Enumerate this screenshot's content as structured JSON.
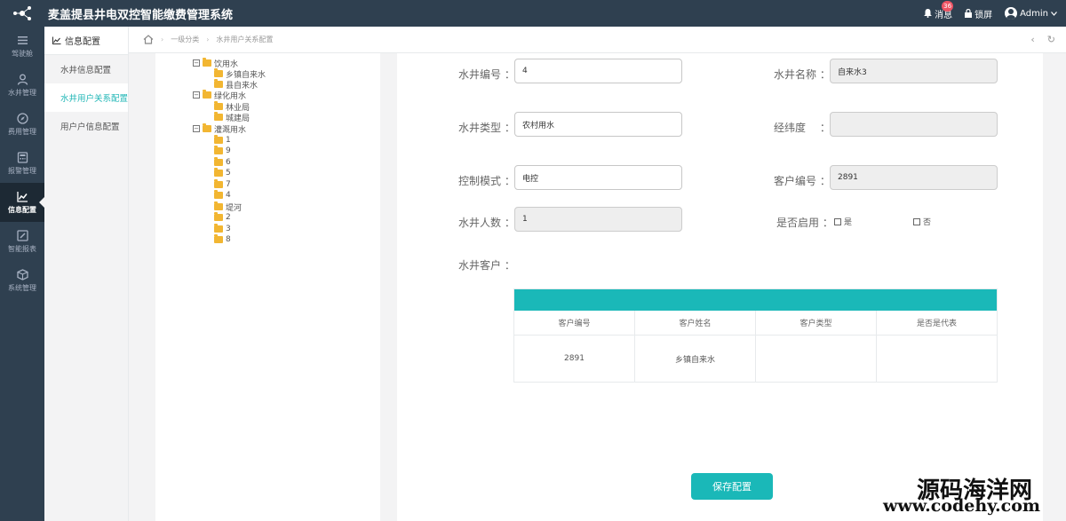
{
  "app": {
    "title": "麦盖提县井电双控智能缴费管理系统"
  },
  "topbar": {
    "messages_label": "消息",
    "messages_count": "36",
    "lock_label": "锁屏",
    "user_label": "Admin"
  },
  "nav": [
    {
      "label": "驾驶舱",
      "icon": "menu-icon"
    },
    {
      "label": "水井管理",
      "icon": "user-icon"
    },
    {
      "label": "费用管理",
      "icon": "compass-icon"
    },
    {
      "label": "报警管理",
      "icon": "calculator-icon"
    },
    {
      "label": "信息配置",
      "icon": "chart-icon",
      "active": true
    },
    {
      "label": "智能报表",
      "icon": "edit-icon"
    },
    {
      "label": "系统管理",
      "icon": "box-icon"
    }
  ],
  "submenu": {
    "header": "信息配置",
    "items": [
      "水井信息配置",
      "水井用户关系配置",
      "用户户信息配置"
    ]
  },
  "breadcrumb": {
    "level1": "一级分类",
    "level2": "水井用户关系配置"
  },
  "tree": {
    "groups": [
      {
        "label": "饮用水",
        "children": [
          "乡镇自来水",
          "县自来水"
        ]
      },
      {
        "label": "绿化用水",
        "children": [
          "林业局",
          "城建局"
        ]
      },
      {
        "label": "灌溉用水",
        "children": [
          "1",
          "9",
          "6",
          "5",
          "7",
          "4",
          "堤河",
          "2",
          "3",
          "8"
        ]
      }
    ]
  },
  "form": {
    "well_no_label": "水井编号 ：",
    "well_no_value": "4",
    "well_name_label": "水井名称 ：",
    "well_name_value": "自来水3",
    "well_type_label": "水井类型 ：",
    "well_type_value": "农村用水",
    "latlng_label": "经纬度 　：",
    "latlng_value": "",
    "control_label": "控制模式 ：",
    "control_value": "电控",
    "customer_no_label": "客户编号 ：",
    "customer_no_value": "2891",
    "people_label": "水井人数 ：",
    "people_value": "1",
    "enabled_label": "是否启用 ：",
    "enabled_yes": "是",
    "enabled_no": "否",
    "customers_label": "水井客户 ："
  },
  "table": {
    "columns": [
      "客户编号",
      "客户姓名",
      "客户类型",
      "是否是代表"
    ],
    "rows": [
      [
        "2891",
        "乡镇自来水",
        "",
        ""
      ]
    ]
  },
  "save_label": "保存配置",
  "watermark": {
    "line1": "源码海洋网",
    "line2": "www.codehy.com"
  }
}
